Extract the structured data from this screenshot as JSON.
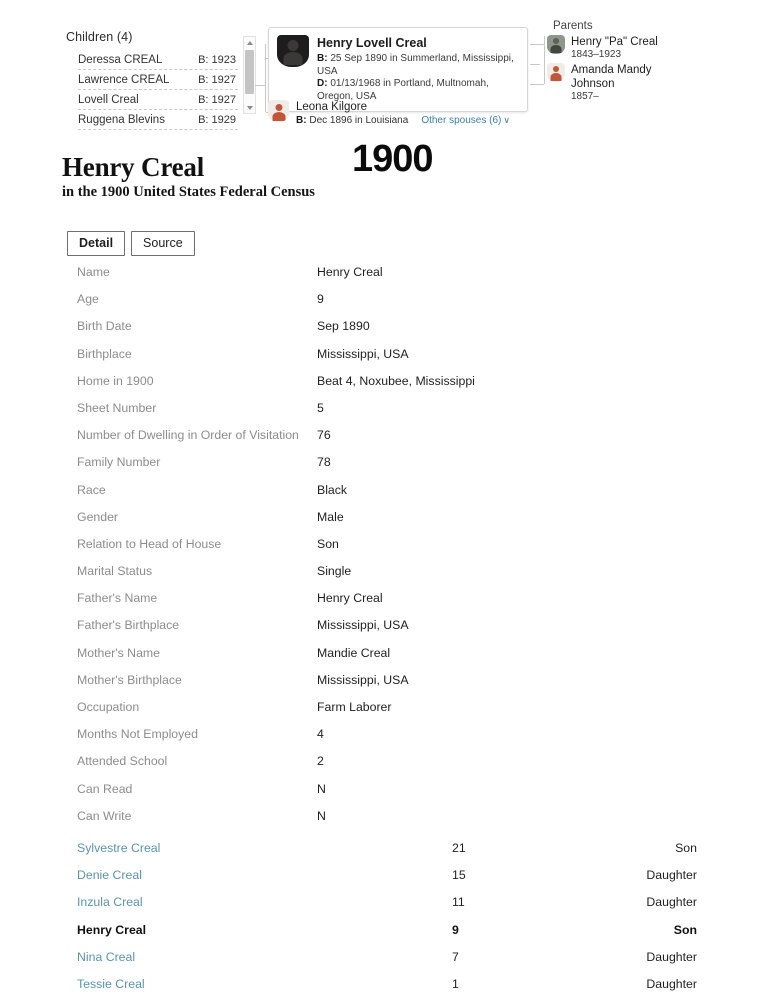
{
  "tree": {
    "children_panel": {
      "heading": "Children (4)",
      "rows": [
        {
          "name": "Deressa CREAL",
          "birth": "B: 1923"
        },
        {
          "name": "Lawrence CREAL",
          "birth": "B: 1927"
        },
        {
          "name": "Lovell Creal",
          "birth": "B: 1927"
        },
        {
          "name": "Ruggena Blevins",
          "birth": "B: 1929"
        }
      ]
    },
    "focus_person": {
      "name": "Henry Lovell Creal",
      "birth_label": "B:",
      "birth": "25 Sep 1890 in Summerland, Mississippi, USA",
      "death_label": "D:",
      "death": "01/13/1968 in Portland, Multnomah, Oregon, USA"
    },
    "spouse": {
      "name": "Leona Kilgore",
      "birth_label": "B:",
      "birth": "Dec 1896 in Louisiana",
      "other_spouses_link": "Other spouses (6)",
      "chevron": "∨"
    },
    "parents": {
      "heading": "Parents",
      "rows": [
        {
          "name": "Henry \"Pa\" Creal",
          "dates": "1843–1923"
        },
        {
          "name": "Amanda Mandy Johnson",
          "dates": "1857–"
        }
      ]
    }
  },
  "header": {
    "person_title": "Henry Creal",
    "subtitle": "in the 1900 United States Federal Census",
    "year": "1900"
  },
  "tabs": [
    {
      "label": "Detail",
      "active": true
    },
    {
      "label": "Source",
      "active": false
    }
  ],
  "detail": {
    "rows": [
      {
        "label": "Name",
        "value": "Henry Creal"
      },
      {
        "label": "Age",
        "value": "9"
      },
      {
        "label": "Birth Date",
        "value": "Sep 1890"
      },
      {
        "label": "Birthplace",
        "value": "Mississippi, USA"
      },
      {
        "label": "Home in 1900",
        "value": "Beat 4, Noxubee, Mississippi"
      },
      {
        "label": "Sheet Number",
        "value": "5"
      },
      {
        "label": "Number of Dwelling in Order of Visitation",
        "value": "76"
      },
      {
        "label": "Family Number",
        "value": "78"
      },
      {
        "label": "Race",
        "value": "Black"
      },
      {
        "label": "Gender",
        "value": "Male"
      },
      {
        "label": "Relation to Head of House",
        "value": "Son"
      },
      {
        "label": "Marital Status",
        "value": "Single"
      },
      {
        "label": "Father's Name",
        "value": "Henry Creal"
      },
      {
        "label": "Father's Birthplace",
        "value": "Mississippi, USA"
      },
      {
        "label": "Mother's Name",
        "value": "Mandie Creal"
      },
      {
        "label": "Mother's Birthplace",
        "value": "Mississippi, USA"
      },
      {
        "label": "Occupation",
        "value": "Farm Laborer"
      },
      {
        "label": "Months Not Employed",
        "value": "4"
      },
      {
        "label": "Attended School",
        "value": "2"
      },
      {
        "label": "Can Read",
        "value": "N"
      },
      {
        "label": "Can Write",
        "value": "N"
      }
    ]
  },
  "household": {
    "rows": [
      {
        "name": "Sylvestre Creal",
        "age": "21",
        "relation": "Son",
        "current": false
      },
      {
        "name": "Denie Creal",
        "age": "15",
        "relation": "Daughter",
        "current": false
      },
      {
        "name": "Inzula Creal",
        "age": "11",
        "relation": "Daughter",
        "current": false
      },
      {
        "name": "Henry Creal",
        "age": "9",
        "relation": "Son",
        "current": true
      },
      {
        "name": "Nina Creal",
        "age": "7",
        "relation": "Daughter",
        "current": false
      },
      {
        "name": "Tessie Creal",
        "age": "1",
        "relation": "Daughter",
        "current": false
      }
    ]
  },
  "colors": {
    "link": "#5b93ad",
    "spouse_link": "#3b7fa6",
    "label": "#8c8c8c",
    "value": "#1f1f1f"
  }
}
